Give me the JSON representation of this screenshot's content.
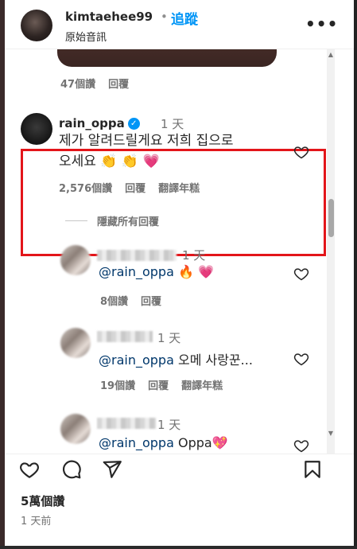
{
  "header": {
    "username": "kimtaehee99",
    "separator": "•",
    "follow_label": "追蹤",
    "subtitle": "原始音訊",
    "more_label": "•••"
  },
  "comments": [
    {
      "id": "prev",
      "likes": "47個讚",
      "reply_label": "回覆"
    },
    {
      "id": "rain",
      "username": "rain_oppa",
      "verified": true,
      "time": "1 天",
      "text_line1": "제가 알려드릴게요 저희 집으로",
      "text_line2": "오세요 👏 👏 💗",
      "likes": "2,576個讚",
      "reply_label": "回覆",
      "translate_label": "翻譯年糕"
    }
  ],
  "hide_replies_label": "隱藏所有回覆",
  "replies": [
    {
      "time": "1 天",
      "mention": "@rain_oppa",
      "text": "🔥 💗",
      "likes": "8個讚",
      "reply_label": "回覆"
    },
    {
      "time": "1 天",
      "mention": "@rain_oppa",
      "text": "오메 사랑꾼...",
      "likes": "19個讚",
      "reply_label": "回覆",
      "translate_label": "翻譯年糕"
    },
    {
      "time": "1 天",
      "mention": "@rain_oppa",
      "text": "Oppa💖"
    }
  ],
  "footer": {
    "likes": "5萬個讚",
    "date": "1 天前"
  },
  "icons": {
    "like": "heart-icon",
    "comment": "comment-icon",
    "share": "send-icon",
    "save": "bookmark-icon"
  },
  "colors": {
    "accent": "#0095f6",
    "highlight": "#e3151a",
    "mention": "#00376b"
  }
}
